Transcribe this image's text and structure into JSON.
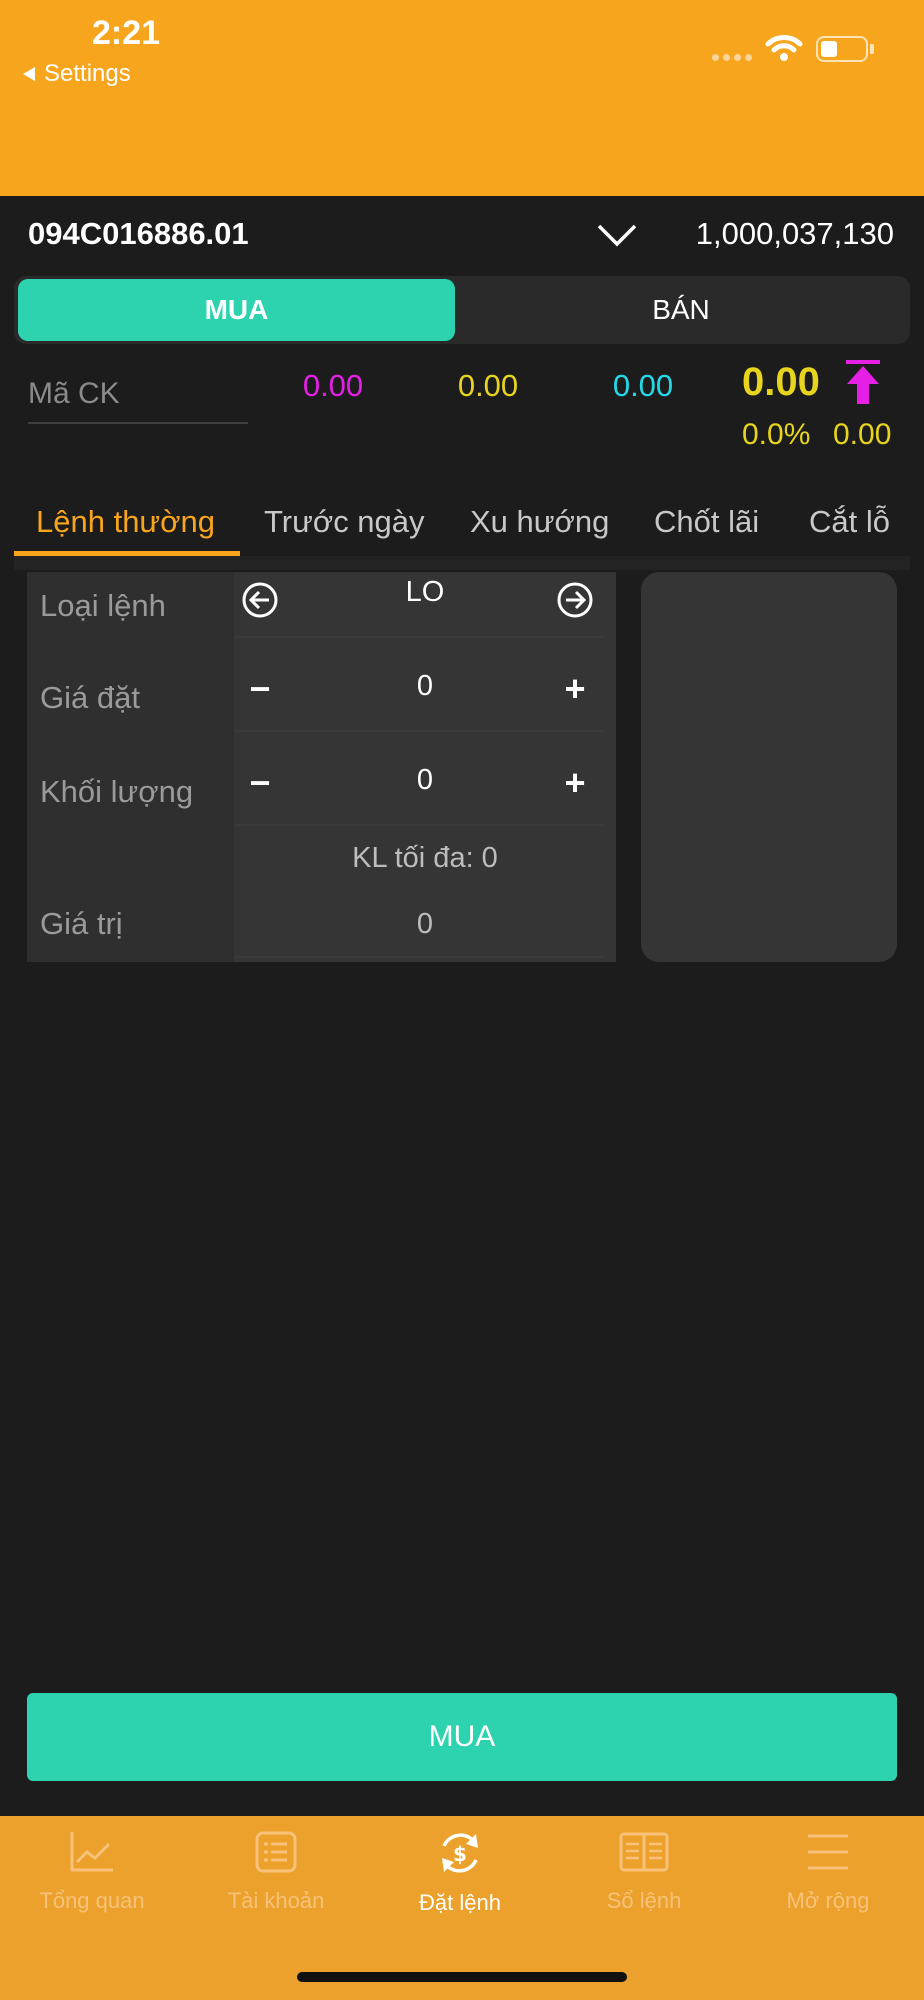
{
  "status_bar": {
    "time": "2:21",
    "back_label": "Settings"
  },
  "account": {
    "id": "094C016886.01",
    "balance": "1,000,037,130"
  },
  "side_tabs": {
    "buy": "MUA",
    "sell": "BÁN"
  },
  "symbol": {
    "placeholder": "Mã CK"
  },
  "prices": {
    "ceiling": "0.00",
    "floor": "0.00",
    "reference": "0.00",
    "last": "0.00",
    "change_pct": "0.0%",
    "change": "0.00"
  },
  "order_tabs": [
    "Lệnh thường",
    "Trước ngày",
    "Xu hướng",
    "Chốt lãi",
    "Cắt lỗ"
  ],
  "form": {
    "order_type_label": "Loại lệnh",
    "order_type_value": "LO",
    "price_label": "Giá đặt",
    "price_value": "0",
    "qty_label": "Khối lượng",
    "qty_value": "0",
    "max_qty": "KL tối đa: 0",
    "value_label": "Giá trị",
    "value_value": "0",
    "minus": "−",
    "plus": "+"
  },
  "submit_label": "MUA",
  "bottom_nav": [
    {
      "label": "Tổng quan",
      "icon": "chart-line-icon"
    },
    {
      "label": "Tài khoản",
      "icon": "list-icon"
    },
    {
      "label": "Đặt lệnh",
      "icon": "dollar-refresh-icon",
      "active": true
    },
    {
      "label": "Sổ lệnh",
      "icon": "book-icon"
    },
    {
      "label": "Mở rộng",
      "icon": "menu-icon"
    }
  ],
  "colors": {
    "header": "#f8a51e",
    "buy": "#2cd3ae",
    "ceiling": "#e61fe6",
    "floor": "#e7d41c",
    "reference": "#22d9e8"
  }
}
